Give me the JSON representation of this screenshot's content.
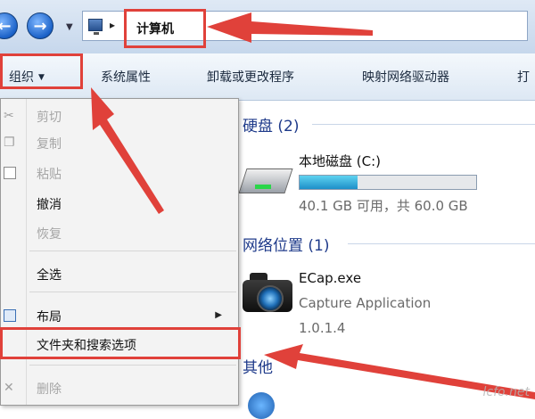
{
  "address_bar": {
    "breadcrumb": "计算机",
    "separator": "▸",
    "pc_icon": "computer-icon"
  },
  "toolbar": {
    "organize": "组织",
    "organize_caret": "▼",
    "system_properties": "系统属性",
    "uninstall": "卸载或更改程序",
    "map_drive": "映射网络驱动器",
    "more": "打"
  },
  "menu": {
    "cut": "剪切",
    "copy": "复制",
    "paste": "粘贴",
    "undo": "撤消",
    "redo": "恢复",
    "select_all": "全选",
    "layout": "布局",
    "folder_options": "文件夹和搜索选项",
    "delete": "删除"
  },
  "content": {
    "hdd_header": "硬盘 (2)",
    "drive": {
      "name": "本地磁盘 (C:)",
      "space": "40.1 GB 可用，共 60.0 GB",
      "used_fraction": 0.33
    },
    "network_header": "网络位置 (1)",
    "app": {
      "name": "ECap.exe",
      "description": "Capture Application",
      "version": "1.0.1.4"
    },
    "other_header": "其他"
  },
  "watermark": "lcfo.net",
  "colors": {
    "highlight": "#e0413a",
    "section_header": "#1e3a8a",
    "drive_fill": "#1e8fc8"
  }
}
